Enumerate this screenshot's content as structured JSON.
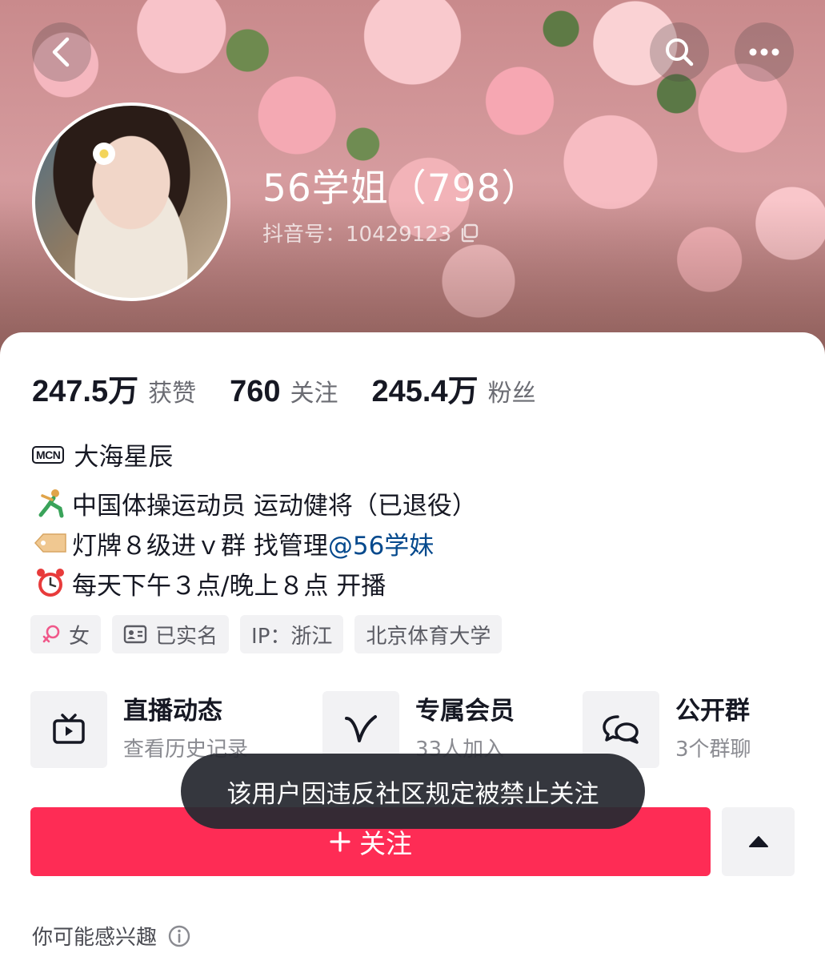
{
  "header": {
    "nickname": "56学姐（798）",
    "douyin_id": "抖音号：10429123"
  },
  "stats": [
    {
      "value": "247.5万",
      "label": "获赞"
    },
    {
      "value": "760",
      "label": "关注"
    },
    {
      "value": "245.4万",
      "label": "粉丝"
    }
  ],
  "mcn": {
    "badge": "MCN",
    "name": "大海星辰"
  },
  "bio": {
    "line1": "中国体操运动员 运动健将（已退役）",
    "line2_text": "灯牌８级进ｖ群 找管理 ",
    "line2_mention": "@56学妹",
    "line3": "每天下午３点/晚上８点 开播"
  },
  "tags": {
    "gender": "女",
    "verified": "已实名",
    "ip": "IP：浙江",
    "school": "北京体育大学"
  },
  "features": [
    {
      "title": "直播动态",
      "sub": "查看历史记录",
      "icon": "tv-icon"
    },
    {
      "title": "专属会员",
      "sub": "33人加入",
      "icon": "v-icon"
    },
    {
      "title": "公开群",
      "sub": "3个群聊",
      "icon": "chat-bubbles-icon"
    }
  ],
  "follow_button": "关注",
  "toast": "该用户因违反社区规定被禁止关注",
  "suggest_title": "你可能感兴趣",
  "colors": {
    "accent": "#fe2c55",
    "mention": "#04498d",
    "tag_bg": "#f2f2f4"
  }
}
